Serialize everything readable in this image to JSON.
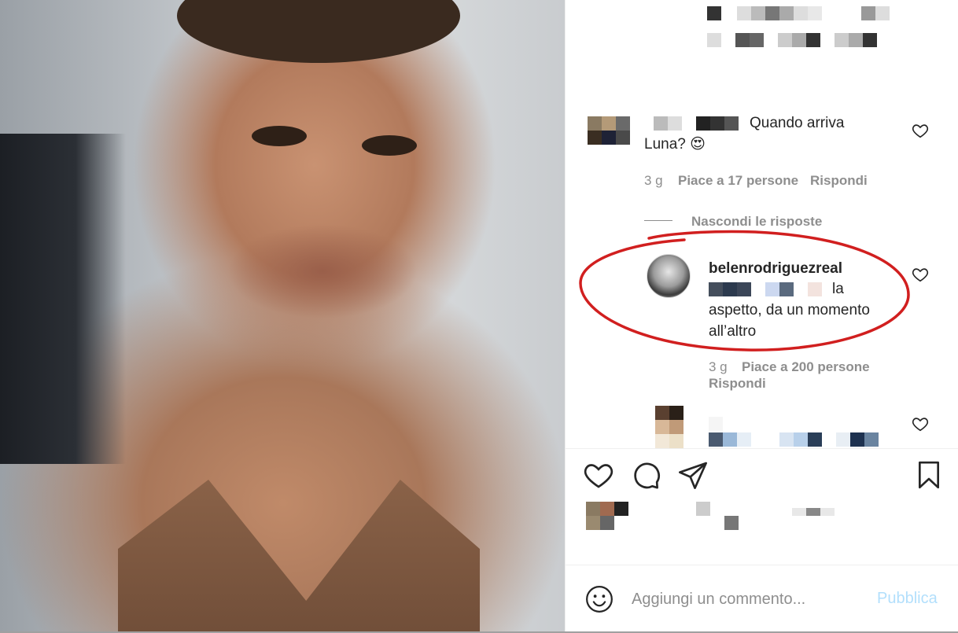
{
  "comments": {
    "first": {
      "text_end": "Quando arriva Luna? 😍",
      "time": "3 g",
      "likes": "Piace a 17 persone",
      "reply": "Rispondi"
    },
    "toggle_replies": "Nascondi le risposte",
    "reply": {
      "username": "belenrodriguezreal",
      "text_line1": "la",
      "text_rest": "aspetto, da un momento all’altro",
      "time": "3 g",
      "likes": "Piace a 200 persone",
      "reply": "Rispondi"
    }
  },
  "add_comment": {
    "placeholder": "Aggiungi un commento...",
    "publish": "Pubblica"
  },
  "icons": {
    "like": "heart-icon",
    "comment": "comment-icon",
    "share": "paper-plane-icon",
    "save": "bookmark-icon",
    "emoji": "smiley-icon"
  },
  "colors": {
    "text": "#262626",
    "muted": "#8e8e8e",
    "publish_disabled": "#b2dffc",
    "annotation": "#d11f1f"
  }
}
